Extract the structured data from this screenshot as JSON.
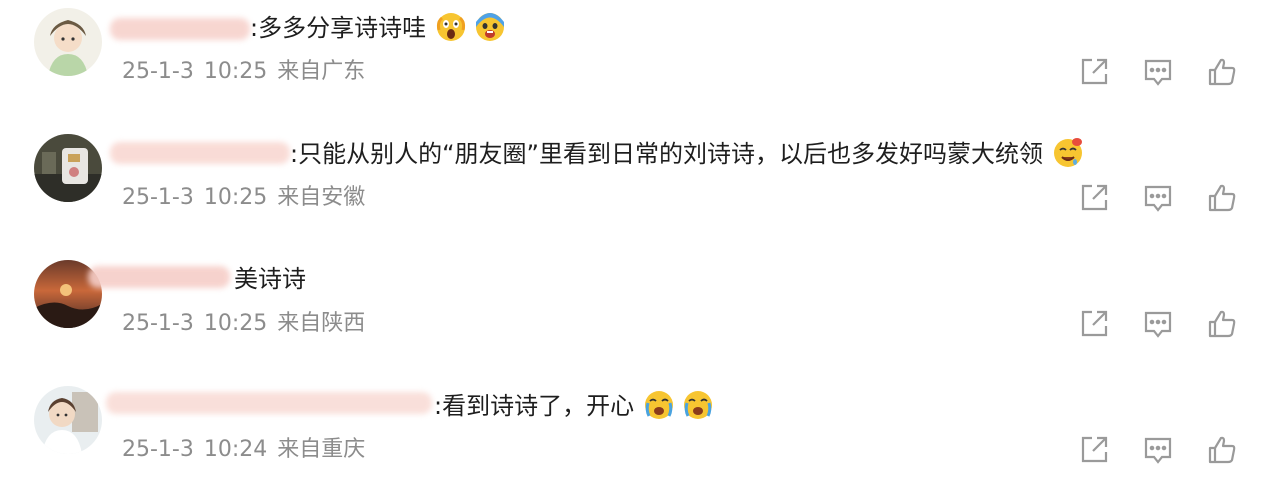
{
  "comments": [
    {
      "separator": ":",
      "text": "多多分享诗诗哇",
      "emojis": [
        "screaming-face-emoji",
        "shocked-face-emoji"
      ],
      "date": "25-1-3",
      "time": "10:25",
      "location": "来自广东"
    },
    {
      "separator": ":",
      "text": "只能从别人的“朋友圈”里看到日常的刘诗诗，以后也多发好吗蒙大统领",
      "emojis": [
        "drooling-face-emoji"
      ],
      "date": "25-1-3",
      "time": "10:25",
      "location": "来自安徽"
    },
    {
      "separator": "",
      "text": "美诗诗",
      "emojis": [],
      "date": "25-1-3",
      "time": "10:25",
      "location": "来自陕西"
    },
    {
      "separator": ":",
      "text": "看到诗诗了，开心",
      "emojis": [
        "crying-laugh-face-emoji",
        "crying-laugh-face-emoji"
      ],
      "date": "25-1-3",
      "time": "10:24",
      "location": "来自重庆"
    }
  ],
  "actions": [
    "share-icon",
    "comment-icon",
    "like-icon"
  ],
  "colors": {
    "text": "#1e1e1e",
    "meta": "#8c8c8c",
    "icon": "#9a9a9a",
    "name_blur": "#f6c9c2"
  }
}
